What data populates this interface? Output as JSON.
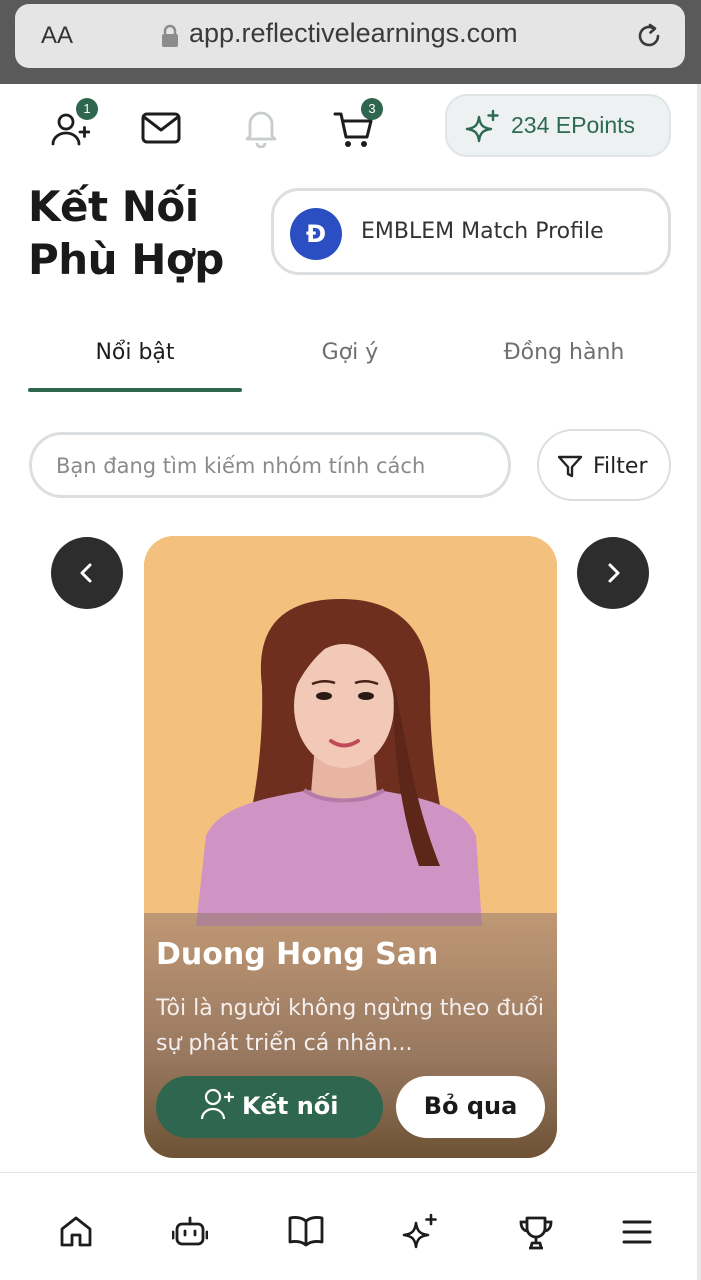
{
  "browser": {
    "aa_label": "AA",
    "url": "app.reflectivelearnings.com"
  },
  "header": {
    "friend_requests_count": "1",
    "cart_count": "3",
    "epoints_label": "234 EPoints"
  },
  "page": {
    "title": "Kết Nối Phù Hợp",
    "emblem_logo": "Đ",
    "emblem_label": "EMBLEM Match Profile"
  },
  "tabs": [
    {
      "label": "Nổi bật",
      "active": true
    },
    {
      "label": "Gợi ý",
      "active": false
    },
    {
      "label": "Đồng hành",
      "active": false
    }
  ],
  "search": {
    "placeholder": "Bạn đang tìm kiếm nhóm tính cách",
    "filter_label": "Filter"
  },
  "profile_card": {
    "name": "Duong Hong San",
    "bio": "Tôi là người không ngừng theo đuổi sự phát triển cá nhân...",
    "connect_label": "Kết nối",
    "skip_label": "Bỏ qua"
  },
  "bottom_nav": [
    "home-icon",
    "robot-icon",
    "book-icon",
    "sparkles-icon",
    "trophy-icon",
    "menu-icon"
  ],
  "colors": {
    "accent": "#2f6650",
    "emblem_blue": "#2b4fc2",
    "card_background": "#f3c07d"
  }
}
